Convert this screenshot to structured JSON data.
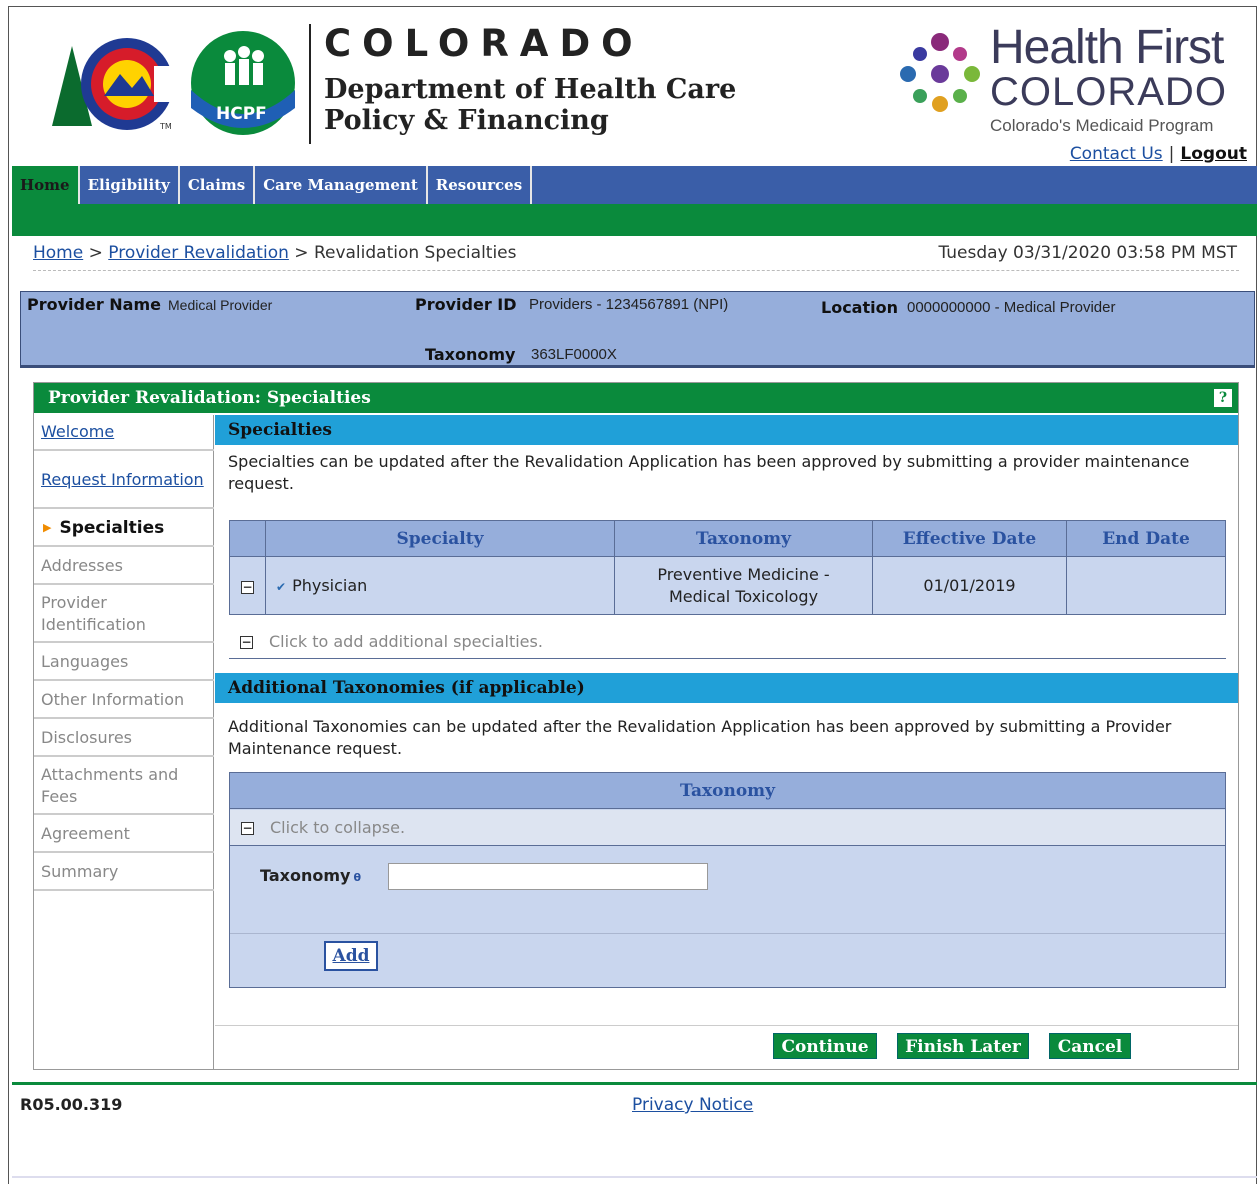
{
  "header": {
    "state": "COLORADO",
    "department": "Department of Health Care Policy & Financing",
    "hcpf_badge": "HCPF",
    "tm": "TM",
    "brand_title": "Health First",
    "brand_state": "COLORADO",
    "brand_tagline": "Colorado's Medicaid Program",
    "contact_link": "Contact Us",
    "separator": "|",
    "logout_link": "Logout"
  },
  "nav": {
    "items": [
      {
        "label": "Home",
        "active": true
      },
      {
        "label": "Eligibility"
      },
      {
        "label": "Claims"
      },
      {
        "label": "Care Management"
      },
      {
        "label": "Resources"
      }
    ]
  },
  "breadcrumb": {
    "home": "Home",
    "sep1": ">",
    "revalidation": "Provider Revalidation",
    "sep2": ">",
    "current": "Revalidation Specialties",
    "datetime": "Tuesday 03/31/2020 03:58 PM MST"
  },
  "provider": {
    "name_label": "Provider Name",
    "name_value": "Medical Provider",
    "id_label": "Provider ID",
    "id_value": "Providers - 1234567891 (NPI)",
    "location_label": "Location",
    "location_value": "0000000000 - Medical Provider",
    "taxonomy_label": "Taxonomy",
    "taxonomy_value": "363LF0000X"
  },
  "panel": {
    "title": "Provider Revalidation: Specialties",
    "help": "?"
  },
  "sidenav": {
    "items": [
      {
        "label": "Welcome"
      },
      {
        "label": "Request Information"
      },
      {
        "label": "Specialties"
      },
      {
        "label": "Addresses"
      },
      {
        "label": "Provider Identification"
      },
      {
        "label": "Languages"
      },
      {
        "label": "Other Information"
      },
      {
        "label": "Disclosures"
      },
      {
        "label": "Attachments and Fees"
      },
      {
        "label": "Agreement"
      },
      {
        "label": "Summary"
      }
    ]
  },
  "specialties": {
    "heading": "Specialties",
    "description": "Specialties can be updated after the Revalidation Application has been approved by submitting a provider maintenance request.",
    "columns": [
      "",
      "Specialty",
      "Taxonomy",
      "Effective Date",
      "End Date"
    ],
    "row": {
      "toggle": "−",
      "check": "✔",
      "specialty": "Physician",
      "taxonomy": "Preventive Medicine - Medical Toxicology",
      "effective_date": "01/01/2019",
      "end_date": ""
    },
    "add_toggle": "−",
    "add_text": "Click to add additional specialties."
  },
  "additional": {
    "heading": "Additional Taxonomies (if applicable)",
    "description": "Additional Taxonomies can be updated after the Revalidation Application has been approved by submitting a Provider Maintenance request.",
    "table_header": "Taxonomy",
    "collapse_toggle": "−",
    "collapse_text": "Click to collapse.",
    "field_label": "Taxonomy",
    "info_mark": "θ",
    "field_value": "",
    "add_button": "Add"
  },
  "actions": {
    "continue": "Continue",
    "finish_later": "Finish Later",
    "cancel": "Cancel"
  },
  "footer": {
    "version": "R05.00.319",
    "privacy": "Privacy Notice"
  }
}
